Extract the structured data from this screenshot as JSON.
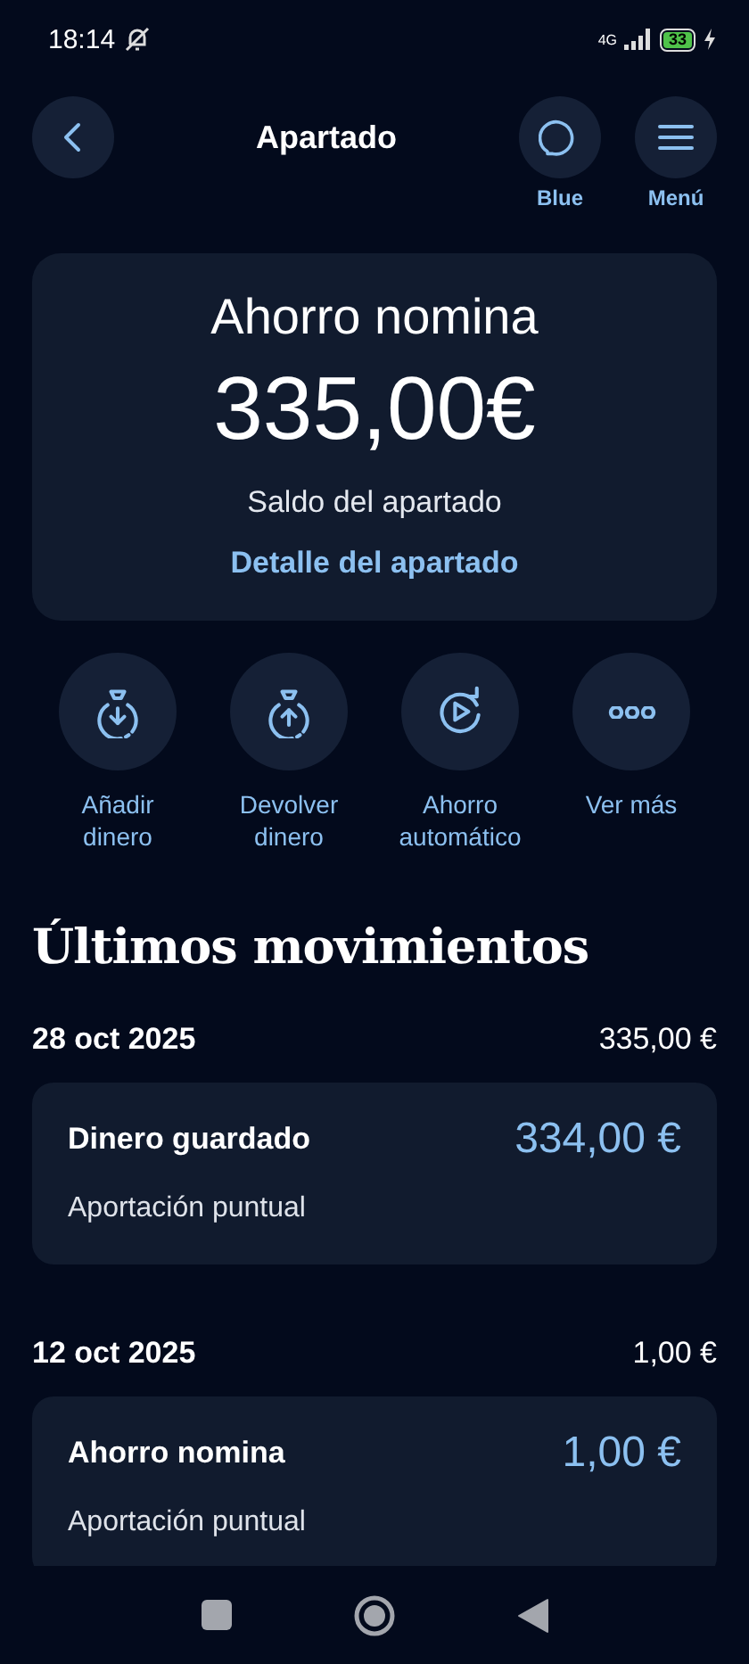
{
  "status_bar": {
    "time": "18:14",
    "network": "4G",
    "battery": "33"
  },
  "header": {
    "title": "Apartado",
    "actions": [
      {
        "kind": "chat",
        "label": "Blue"
      },
      {
        "kind": "menu",
        "label": "Menú"
      }
    ]
  },
  "balance_card": {
    "name": "Ahorro nomina",
    "amount": "335,00€",
    "caption": "Saldo del apartado",
    "link": "Detalle del apartado"
  },
  "quick_actions": [
    {
      "kind": "add",
      "label": "Añadir dinero"
    },
    {
      "kind": "return",
      "label": "Devolver dinero"
    },
    {
      "kind": "auto",
      "label": "Ahorro automático"
    },
    {
      "kind": "more",
      "label": "Ver más"
    }
  ],
  "movements": {
    "title": "Últimos movimientos",
    "groups": [
      {
        "date": "28 oct 2025",
        "total": "335,00 €",
        "items": [
          {
            "title": "Dinero guardado",
            "amount": "334,00 €",
            "subtitle": "Aportación puntual"
          }
        ]
      },
      {
        "date": "12 oct 2025",
        "total": "1,00 €",
        "items": [
          {
            "title": "Ahorro nomina",
            "amount": "1,00 €",
            "subtitle": "Aportación puntual"
          }
        ]
      }
    ]
  }
}
